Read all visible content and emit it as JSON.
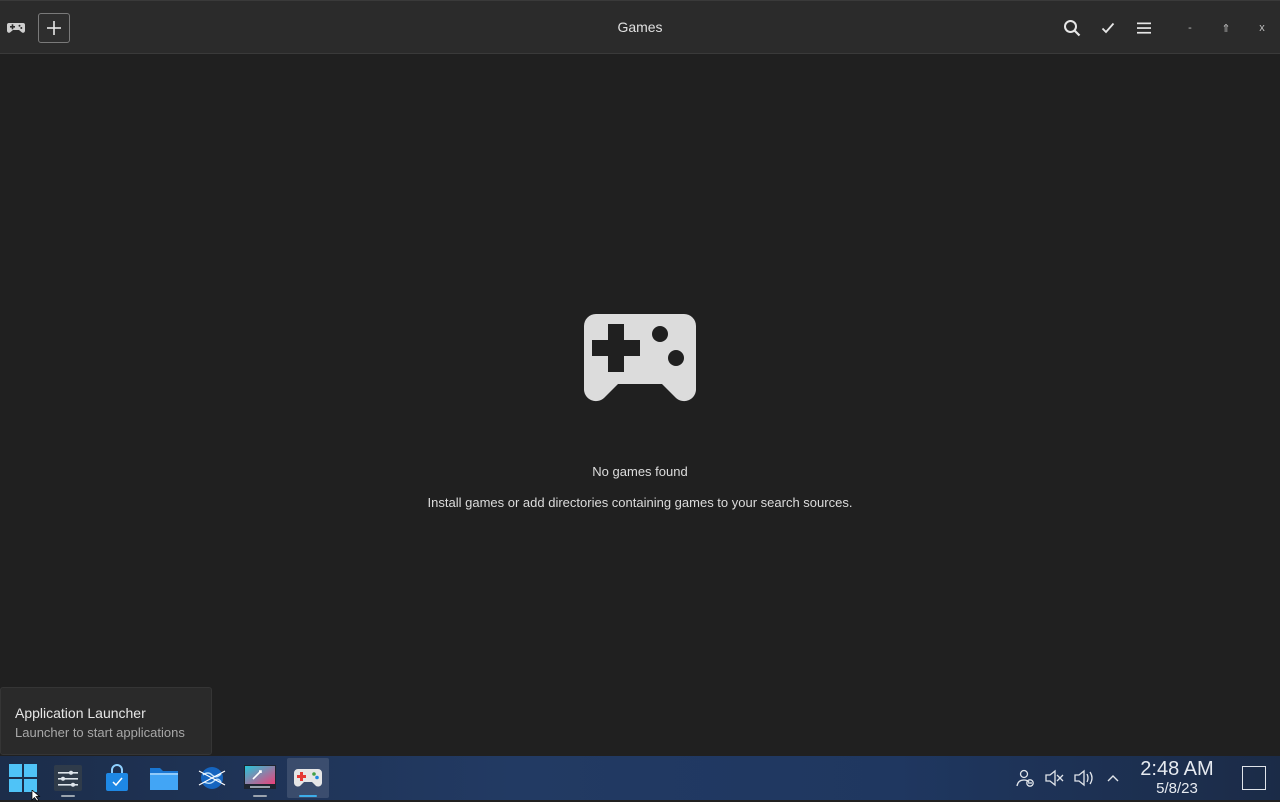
{
  "header": {
    "title": "Games",
    "window_controls": {
      "minimize": "-",
      "maximize": "⇑",
      "close": "x"
    },
    "icons": [
      "gamepad-icon",
      "add-icon",
      "search-icon",
      "check-icon",
      "menu-icon"
    ]
  },
  "empty_state": {
    "title": "No games found",
    "subtitle": "Install games or add directories containing games to your search sources."
  },
  "tooltip": {
    "title": "Application Launcher",
    "subtitle": "Launcher to start applications"
  },
  "taskbar": {
    "items": [
      "application-launcher",
      "system-settings",
      "discover-store",
      "file-manager",
      "web-browser",
      "screen-tool",
      "games-app"
    ],
    "tray": [
      "user-icon",
      "mute-icon",
      "volume-icon",
      "tray-expand-icon"
    ],
    "clock": {
      "time": "2:48 AM",
      "date": "5/8/23"
    }
  },
  "colors": {
    "accent": "#3daee9",
    "background": "#202020",
    "header": "#2b2b2b"
  }
}
